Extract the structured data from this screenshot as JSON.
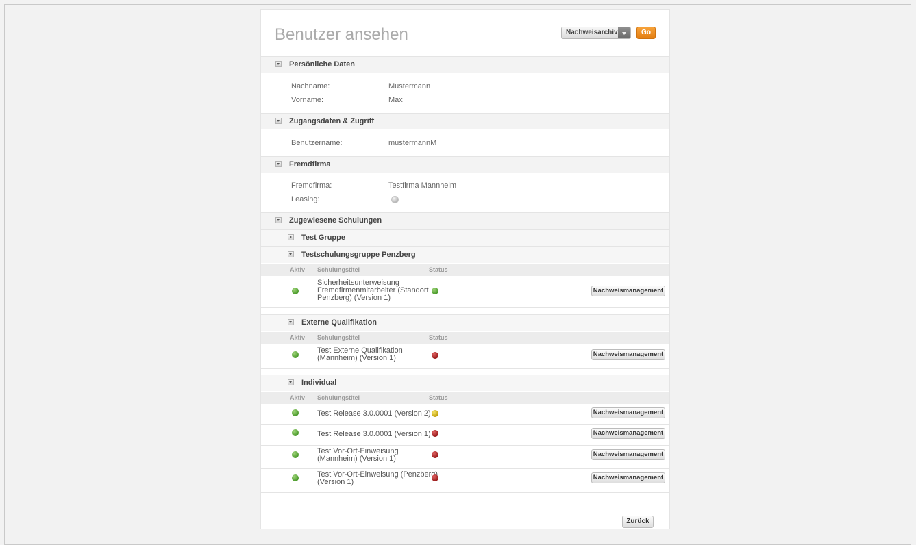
{
  "page_title": "Benutzer ansehen",
  "archive_select": {
    "selected": "Nachweisarchiv"
  },
  "go_label": "Go",
  "sections": {
    "personal": {
      "title": "Persönliche Daten",
      "fields": [
        {
          "label": "Nachname:",
          "value": "Mustermann"
        },
        {
          "label": "Vorname:",
          "value": "Max"
        }
      ]
    },
    "access": {
      "title": "Zugangsdaten & Zugriff",
      "fields": [
        {
          "label": "Benutzername:",
          "value": "mustermannM"
        }
      ]
    },
    "company": {
      "title": "Fremdfirma",
      "fields": [
        {
          "label": "Fremdfirma:",
          "value": "Testfirma Mannheim"
        },
        {
          "label": "Leasing:",
          "value": ""
        }
      ]
    },
    "trainings": {
      "title": "Zugewiesene Schulungen"
    }
  },
  "table_headers": {
    "active": "Aktiv",
    "title": "Schulungstitel",
    "status": "Status"
  },
  "groups": [
    {
      "name": "Test Gruppe",
      "expanded": false,
      "rows": []
    },
    {
      "name": "Testschulungsgruppe Penzberg",
      "expanded": true,
      "rows": [
        {
          "active": "green",
          "title": "Sicherheitsunterweisung Fremdfirmenmitarbeiter (Standort Penzberg) (Version 1)",
          "status": "green"
        }
      ]
    },
    {
      "name": "Externe Qualifikation",
      "expanded": true,
      "rows": [
        {
          "active": "green",
          "title": "Test Externe Qualifikation (Mannheim) (Version 1)",
          "status": "red"
        }
      ]
    },
    {
      "name": "Individual",
      "expanded": true,
      "rows": [
        {
          "active": "green",
          "title": "Test Release 3.0.0001 (Version 2)",
          "status": "yellow"
        },
        {
          "active": "green",
          "title": "Test Release 3.0.0001 (Version 1)",
          "status": "red"
        },
        {
          "active": "green",
          "title": "Test Vor-Ort-Einweisung (Mannheim) (Version 1)",
          "status": "red"
        },
        {
          "active": "green",
          "title": "Test Vor-Ort-Einweisung (Penzberg) (Version 1)",
          "status": "red"
        }
      ]
    }
  ],
  "row_button_label": "Nachweismanagement",
  "back_label": "Zurück",
  "colors": {
    "accent": "#e8851a",
    "status_green": "#4a9a2a",
    "status_red": "#9a1c1c",
    "status_yellow": "#c2a10c"
  }
}
